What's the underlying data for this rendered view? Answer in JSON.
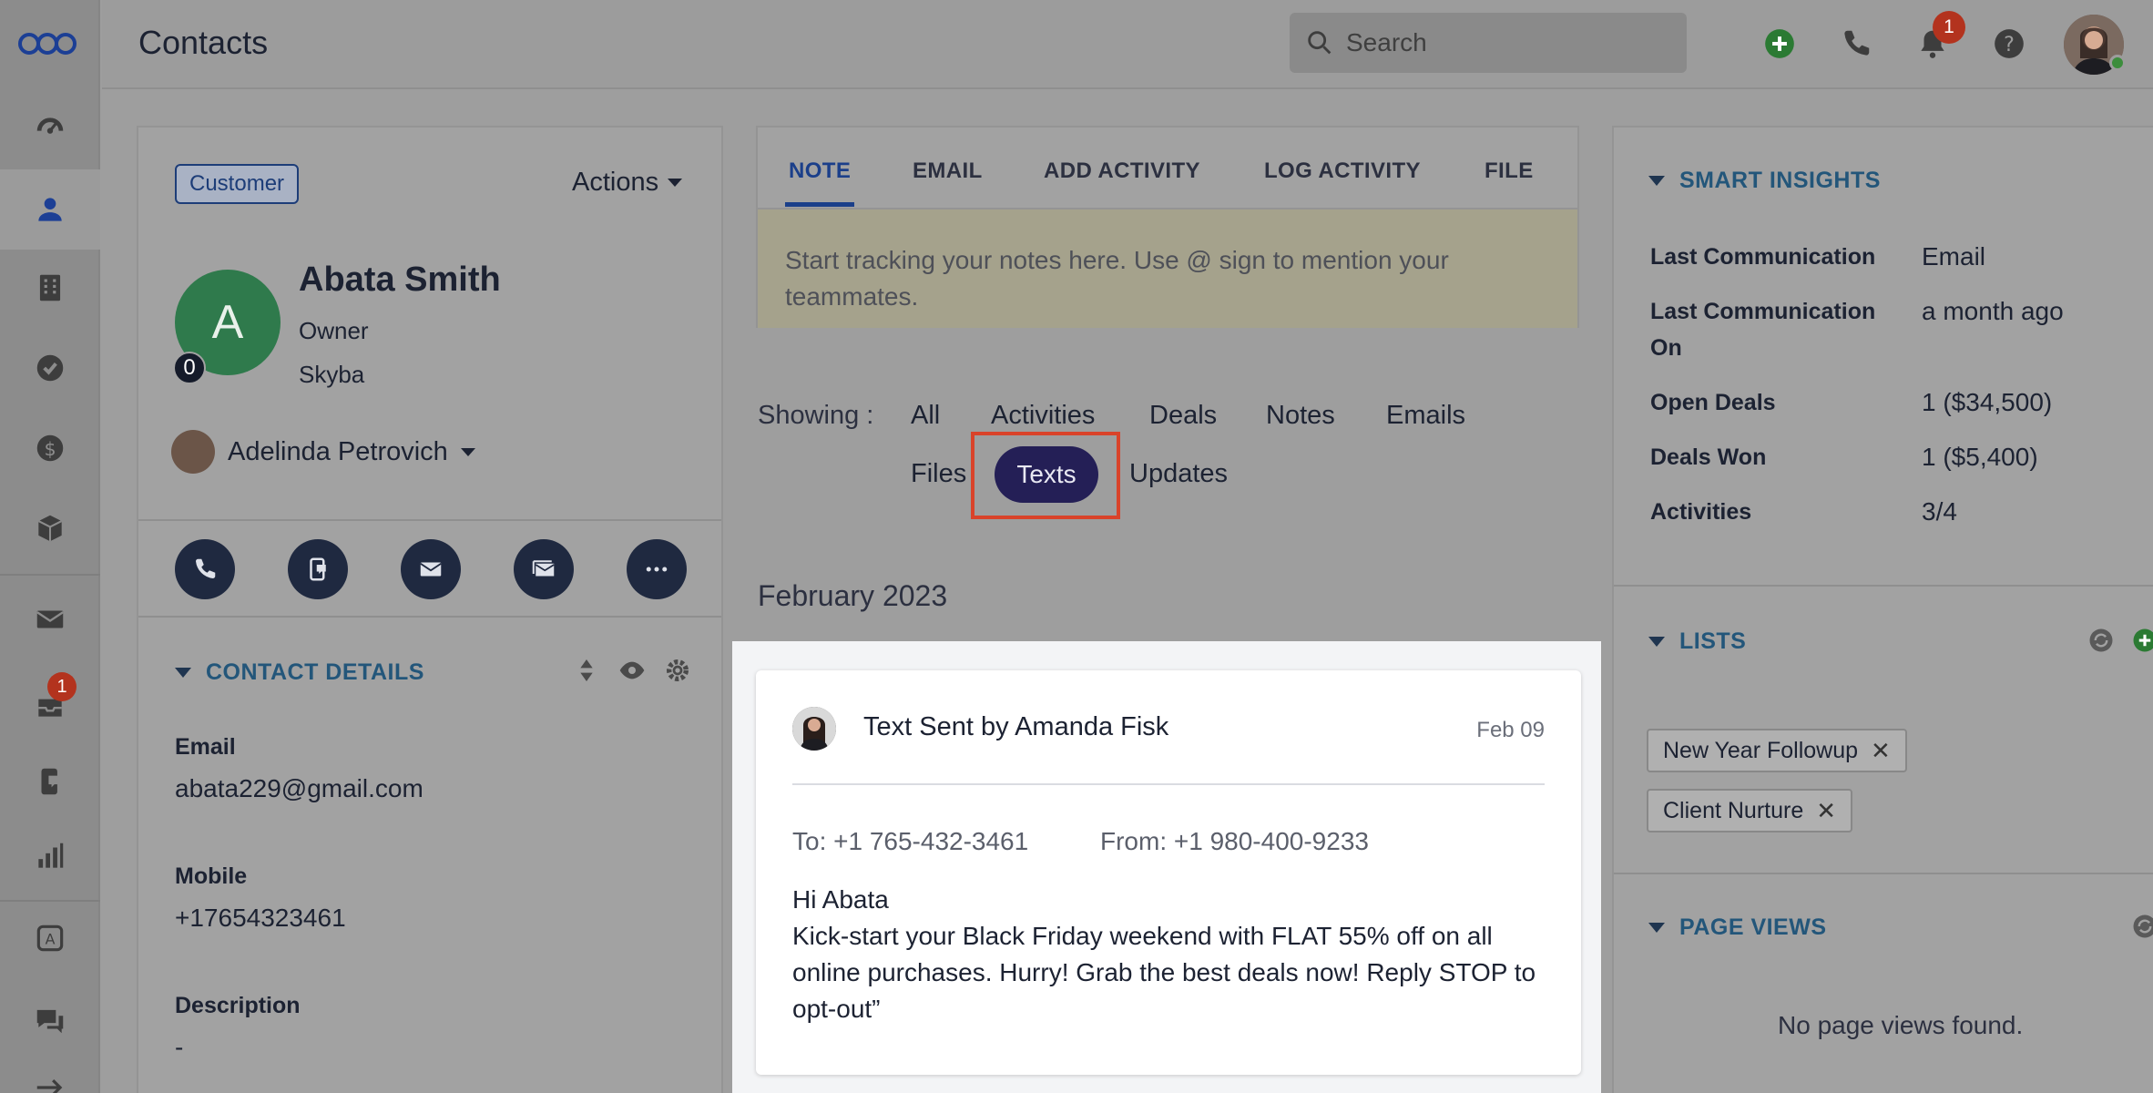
{
  "app": {
    "page_title": "Contacts"
  },
  "search": {
    "placeholder": "Search"
  },
  "topbar": {
    "notification_count": "1"
  },
  "nav": {
    "inbox_badge": "1"
  },
  "contact": {
    "type_badge": "Customer",
    "actions_label": "Actions",
    "avatar_letter": "A",
    "score": "0",
    "name": "Abata Smith",
    "role": "Owner",
    "company": "Skyba",
    "owner": "Adelinda Petrovich"
  },
  "contact_details": {
    "heading": "CONTACT DETAILS",
    "fields": [
      {
        "label": "Email",
        "value": "abata229@gmail.com"
      },
      {
        "label": "Mobile",
        "value": "+17654323461"
      },
      {
        "label": "Description",
        "value": "-"
      }
    ]
  },
  "composer": {
    "tabs": [
      "NOTE",
      "EMAIL",
      "ADD ACTIVITY",
      "LOG ACTIVITY",
      "FILE"
    ],
    "active_tab": "NOTE",
    "placeholder": "Start tracking your notes here. Use @ sign to mention your teammates."
  },
  "timeline": {
    "showing_label": "Showing :",
    "filters": [
      "All",
      "Activities",
      "Deals",
      "Notes",
      "Emails",
      "Files",
      "Texts",
      "Updates"
    ],
    "active_filter": "Texts",
    "month": "February 2023",
    "card": {
      "title_bold": "Text Sent",
      "title_by": "by",
      "author": "Amanda Fisk",
      "date": "Feb 09",
      "to": "To: +1 765-432-3461",
      "from": "From: +1 980-400-9233",
      "greeting": "Hi Abata",
      "message": "Kick-start your Black Friday weekend with FLAT 55% off on all online purchases. Hurry! Grab the best deals now! Reply STOP to opt-out”"
    }
  },
  "smart_insights": {
    "heading": "SMART INSIGHTS",
    "rows": [
      {
        "label": "Last Communication",
        "value": "Email"
      },
      {
        "label": "Last Communication On",
        "value": "a month ago"
      },
      {
        "label": "Open Deals",
        "value": "1 ($34,500)"
      },
      {
        "label": "Deals Won",
        "value": "1 ($5,400)"
      },
      {
        "label": "Activities",
        "value": "3/4"
      }
    ]
  },
  "lists": {
    "heading": "LISTS",
    "items": [
      "New Year Followup",
      "Client Nurture"
    ]
  },
  "page_views": {
    "heading": "PAGE VIEWS",
    "empty_text": "No page views found."
  },
  "colors": {
    "accent": "#241f56",
    "highlight": "#d9432a",
    "link_teal": "#23567a",
    "badge_red": "#b3331e",
    "avatar_green": "#2f7a4c"
  }
}
